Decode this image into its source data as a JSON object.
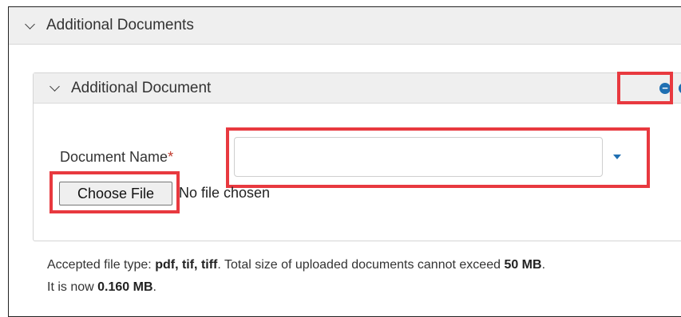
{
  "outer_section": {
    "title": "Additional Documents"
  },
  "inner_section": {
    "title": "Additional Document",
    "remove_icon": "minus-circle-icon",
    "add_icon": "plus-circle-icon",
    "icon_color": "#1f6fb2"
  },
  "form": {
    "document_name_label": "Document Name",
    "required_marker": "*",
    "document_name_value": "",
    "choose_file_label": "Choose File",
    "no_file_text": "No file chosen"
  },
  "info": {
    "accepted_prefix": "Accepted file type: ",
    "file_types": "pdf, tif, tiff",
    "total_text": ". Total size of uploaded documents cannot exceed ",
    "max_size": "50 MB",
    "period": ".",
    "now_prefix": "It is now ",
    "current_size": "0.160 MB",
    "now_suffix": "."
  },
  "highlight_color": "#e8393f"
}
